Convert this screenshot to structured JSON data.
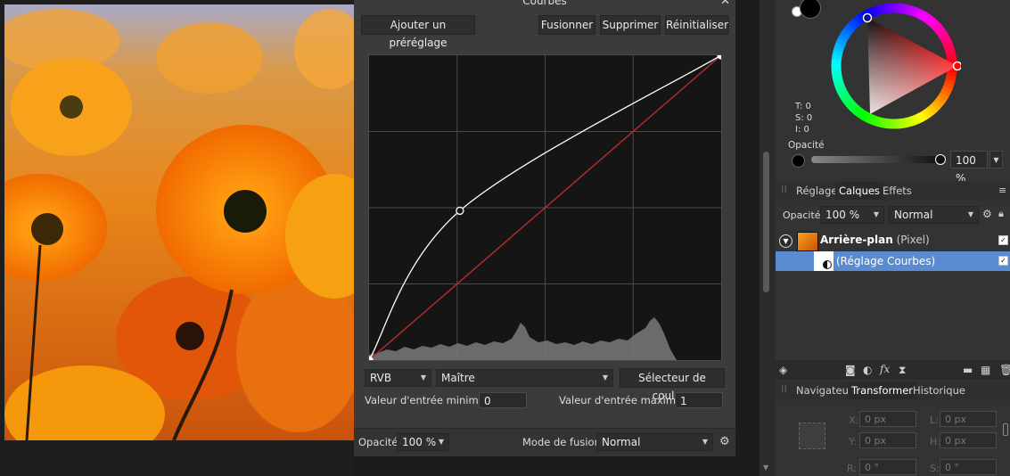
{
  "dialog": {
    "title": "Courbes",
    "close_glyph": "✕",
    "add_preset": "Ajouter un préréglage",
    "merge": "Fusionner",
    "delete": "Supprimer",
    "reset": "Réinitialiser",
    "channel": "RVB",
    "mode_select": "Maître",
    "color_picker": "Sélecteur de couleur",
    "min_label": "Valeur d'entrée minimum:",
    "min_value": "0",
    "max_label": "Valeur d'entrée maximum:",
    "max_value": "1",
    "opacity_label": "Opacité:",
    "opacity_value": "100 %",
    "blend_label": "Mode de fusion:",
    "blend_value": "Normal"
  },
  "color": {
    "t_label": "T: 0",
    "s_label": "S: 0",
    "l_label": "I: 0",
    "opacity_label": "Opacité",
    "opacity_value": "100 %",
    "opacity_level": 1.0,
    "hue_color": "#ff0000"
  },
  "layers_panel": {
    "tabs": [
      "Réglage",
      "Calques",
      "Effets"
    ],
    "active_tab": "Calques",
    "opacity_label": "Opacité:",
    "opacity_value": "100 %",
    "blend_value": "Normal",
    "layers": [
      {
        "name": "Arrière-plan",
        "type": "(Pixel)",
        "checked": true
      },
      {
        "name": "(Réglage Courbes)",
        "checked": true
      }
    ]
  },
  "transform_panel": {
    "tabs": [
      "Navigateur",
      "Transformer",
      "Historique"
    ],
    "active_tab": "Transformer",
    "x_label": "X:",
    "x_value": "0 px",
    "y_label": "Y:",
    "y_value": "0 px",
    "l_label": "L:",
    "l_value": "0 px",
    "h_label": "H:",
    "h_value": "0 px",
    "r_label": "R:",
    "r_value": "0 °",
    "s_label": "S:",
    "s_value": "0 °"
  },
  "curve": {
    "points": [
      [
        0,
        0
      ],
      [
        0.258,
        0.49
      ],
      [
        1,
        1
      ]
    ]
  }
}
